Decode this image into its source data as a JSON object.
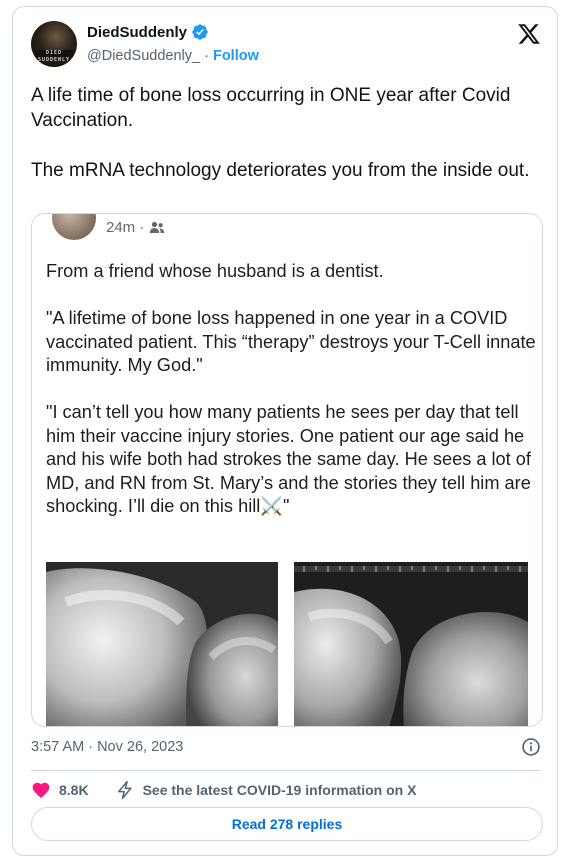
{
  "tweet": {
    "author_name": "DiedSuddenly",
    "author_handle": "@DiedSuddenly_",
    "follow_separator": " · ",
    "follow_label": "Follow",
    "avatar_strip_text": "DIED SUDDENLY",
    "text": "A life time of bone loss occurring in ONE year after Covid Vaccination.\n\nThe mRNA technology deteriorates you from the inside out.",
    "timestamp": "3:57 AM · Nov 26, 2023",
    "likes": "8.8K",
    "covid_info": "See the latest COVID-19 information on X",
    "read_replies": "Read 278 replies",
    "icons": {
      "verified": "verified-badge-icon",
      "logo": "x-logo-icon",
      "info": "info-icon",
      "like": "heart-icon",
      "covid": "lightning-icon"
    },
    "colors": {
      "accent": "#1d9bf0",
      "like": "#f91880",
      "text": "#0f1419",
      "secondary": "#536471"
    }
  },
  "embedded_post": {
    "time": "24m ·",
    "text": "From a friend whose husband is a dentist.\n\n\"A lifetime of bone loss happened in one year in a COVID vaccinated patient. This “therapy” destroys your T-Cell innate immunity. My God.\"\n\n\"I can’t tell you how many patients he sees per day that tell him their vaccine injury stories. One patient our age said he and his wife both had strokes the same day. He sees a lot of MD, and RN from St. Mary’s and the stories they tell him are shocking. I’ll die on this hill⚔️\""
  }
}
